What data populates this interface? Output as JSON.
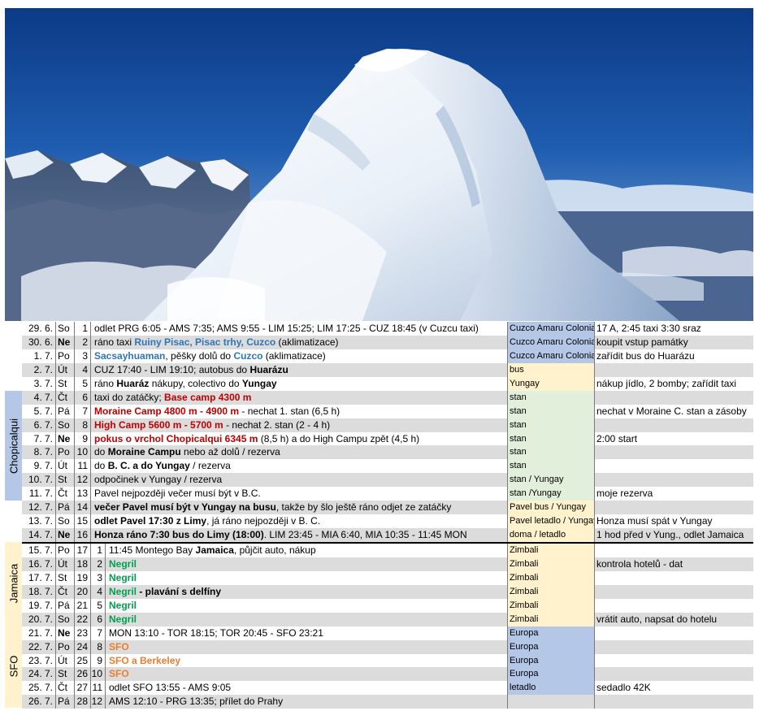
{
  "colors": {
    "accom_blue": "#b4c7e7",
    "accom_yellow": "#fff2cc",
    "accom_green": "#e2efda",
    "band_chopicalqui": "#b4c7e7",
    "band_jamaica": "#fff2cc",
    "band_sfo": "#fff2cc",
    "text_red": "#c00000",
    "text_blue": "#2e75b6",
    "text_green": "#00a050",
    "text_orange": "#ed7d31",
    "row_gray": "#dcdcdc"
  },
  "bands": [
    {
      "label": "Chopicalqui",
      "start": 5,
      "end": 12
    },
    {
      "label": "Jamaica",
      "start": 16,
      "end": 21
    },
    {
      "label": "SFO",
      "start": 22,
      "end": 27
    }
  ],
  "rows": [
    {
      "date": "29. 6.",
      "dow": "So",
      "dow_bold": false,
      "day": "1",
      "sub": "",
      "accom": "Cuzco Amaru Colonial",
      "accom_color": "blue",
      "note": "17 A, 2:45 taxi 3:30 sraz",
      "parts": [
        {
          "t": "odlet PRG 6:05 - AMS 7:35; AMS 9:55 - LIM 15:25; LIM 17:25 - CUZ 18:45  (v Cuzcu taxi)",
          "s": ""
        }
      ]
    },
    {
      "date": "30. 6.",
      "dow": "Ne",
      "dow_bold": true,
      "day": "2",
      "sub": "",
      "accom": "Cuzco Amaru Colonial",
      "accom_color": "blue",
      "note": "koupit vstup památky",
      "parts": [
        {
          "t": "ráno taxi ",
          "s": ""
        },
        {
          "t": "Ruiny Pisac, Pisac trhy, Cuzco",
          "s": "blue"
        },
        {
          "t": " (aklimatizace)",
          "s": ""
        }
      ]
    },
    {
      "date": "1. 7.",
      "dow": "Po",
      "dow_bold": false,
      "day": "3",
      "sub": "",
      "accom": "Cuzco Amaru Colonial",
      "accom_color": "blue",
      "note": "zařídit bus do Huarázu",
      "parts": [
        {
          "t": "Sacsayhuaman",
          "s": "blue"
        },
        {
          "t": ", pěšky dolů do ",
          "s": ""
        },
        {
          "t": "Cuzco",
          "s": "blue"
        },
        {
          "t": "  (aklimatizace)",
          "s": ""
        }
      ]
    },
    {
      "date": "2. 7.",
      "dow": "Út",
      "dow_bold": false,
      "day": "4",
      "sub": "",
      "accom": "bus",
      "accom_color": "yellow",
      "note": "",
      "parts": [
        {
          "t": "CUZ 17:40 - LIM 19:10; autobus do ",
          "s": ""
        },
        {
          "t": "Huarázu",
          "s": "bold"
        }
      ]
    },
    {
      "date": "3. 7.",
      "dow": "St",
      "dow_bold": false,
      "day": "5",
      "sub": "",
      "accom": "Yungay",
      "accom_color": "yellow",
      "note": "nákup jídlo, 2 bomby; zařídit taxi",
      "parts": [
        {
          "t": "ráno ",
          "s": ""
        },
        {
          "t": "Huaráz",
          "s": "bold"
        },
        {
          "t": " nákupy, colectivo do ",
          "s": ""
        },
        {
          "t": "Yungay",
          "s": "bold"
        }
      ]
    },
    {
      "date": "4. 7.",
      "dow": "Čt",
      "dow_bold": false,
      "day": "6",
      "sub": "",
      "accom": "stan",
      "accom_color": "green",
      "note": "",
      "parts": [
        {
          "t": "taxi do zatáčky; ",
          "s": ""
        },
        {
          "t": "Base camp 4300 m",
          "s": "red"
        }
      ]
    },
    {
      "date": "5. 7.",
      "dow": "Pá",
      "dow_bold": false,
      "day": "7",
      "sub": "",
      "accom": "stan",
      "accom_color": "green",
      "note": "nechat v Moraine C. stan a zásoby",
      "parts": [
        {
          "t": "Moraine Camp 4800 m - 4900 m",
          "s": "red"
        },
        {
          "t": " - nechat 1. stan (6,5 h)",
          "s": ""
        }
      ]
    },
    {
      "date": "6. 7.",
      "dow": "So",
      "dow_bold": false,
      "day": "8",
      "sub": "",
      "accom": "stan",
      "accom_color": "green",
      "note": "",
      "parts": [
        {
          "t": "High Camp 5600 m - 5700 m",
          "s": "red"
        },
        {
          "t": " - nechat 2. stan (2 - 4 h)",
          "s": ""
        }
      ]
    },
    {
      "date": "7. 7.",
      "dow": "Ne",
      "dow_bold": true,
      "day": "9",
      "sub": "",
      "accom": "stan",
      "accom_color": "green",
      "note": "2:00 start",
      "parts": [
        {
          "t": "pokus o vrchol Chopicalqui 6345 m",
          "s": "red"
        },
        {
          "t": " (8,5 h) a do High Campu zpět (4,5 h)",
          "s": ""
        }
      ]
    },
    {
      "date": "8. 7.",
      "dow": "Po",
      "dow_bold": false,
      "day": "10",
      "sub": "",
      "accom": "stan",
      "accom_color": "green",
      "note": "",
      "parts": [
        {
          "t": "do ",
          "s": ""
        },
        {
          "t": "Moraine Campu",
          "s": "bold"
        },
        {
          "t": " nebo až dolů / rezerva",
          "s": ""
        }
      ]
    },
    {
      "date": "9. 7.",
      "dow": "Út",
      "dow_bold": false,
      "day": "11",
      "sub": "",
      "accom": "stan",
      "accom_color": "green",
      "note": "",
      "parts": [
        {
          "t": "do ",
          "s": ""
        },
        {
          "t": "B. C. a do Yungay",
          "s": "bold"
        },
        {
          "t": " / rezerva",
          "s": ""
        }
      ]
    },
    {
      "date": "10. 7.",
      "dow": "St",
      "dow_bold": false,
      "day": "12",
      "sub": "",
      "accom": "stan / Yungay",
      "accom_color": "green",
      "note": "",
      "parts": [
        {
          "t": "odpočinek v Yungay / rezerva",
          "s": ""
        }
      ]
    },
    {
      "date": "11. 7.",
      "dow": "Čt",
      "dow_bold": false,
      "day": "13",
      "sub": "",
      "accom": "stan /Yungay",
      "accom_color": "green",
      "note": "moje rezerva",
      "parts": [
        {
          "t": "Pavel nejpozději večer musí být v B.C.",
          "s": ""
        }
      ]
    },
    {
      "date": "12. 7.",
      "dow": "Pá",
      "dow_bold": false,
      "day": "14",
      "sub": "",
      "accom": "Pavel bus / Yungay",
      "accom_color": "yellow",
      "note": "",
      "parts": [
        {
          "t": "večer Pavel musí být v Yungay na busu",
          "s": "bold"
        },
        {
          "t": ", takže by šlo ještě ráno odjet ze zatáčky",
          "s": ""
        }
      ]
    },
    {
      "date": "13. 7.",
      "dow": "So",
      "dow_bold": false,
      "day": "15",
      "sub": "",
      "accom": "Pavel letadlo / Yungay",
      "accom_color": "yellow",
      "note": "Honza musí spát v Yungay",
      "parts": [
        {
          "t": "odlet Pavel 17:30 z Limy",
          "s": "bold"
        },
        {
          "t": ", já ráno nejpozději v B. C.",
          "s": ""
        }
      ]
    },
    {
      "date": "14. 7.",
      "dow": "Ne",
      "dow_bold": true,
      "day": "16",
      "sub": "",
      "accom": "doma / letadlo",
      "accom_color": "yellow",
      "note": "1 hod před v Yung., odlet Jamaica",
      "parts": [
        {
          "t": "Honza ráno 7:30 bus do Limy (18:00)",
          "s": "bold"
        },
        {
          "t": ". LIM 23:45 - MIA 6:40, MIA 10:35 - 11:45 MON",
          "s": ""
        }
      ]
    },
    {
      "date": "15. 7.",
      "dow": "Po",
      "dow_bold": false,
      "day": "17",
      "sub": "1",
      "accom": "Zimbali",
      "accom_color": "yellow",
      "note": "",
      "parts": [
        {
          "t": "11:45 Montego Bay ",
          "s": ""
        },
        {
          "t": "Jamaica",
          "s": "bold"
        },
        {
          "t": ", půjčit auto, nákup",
          "s": ""
        }
      ]
    },
    {
      "date": "16. 7.",
      "dow": "Út",
      "dow_bold": false,
      "day": "18",
      "sub": "2",
      "accom": "Zimbali",
      "accom_color": "yellow",
      "note": "kontrola hotelů - dat",
      "parts": [
        {
          "t": "Negril",
          "s": "green"
        }
      ]
    },
    {
      "date": "17. 7.",
      "dow": "St",
      "dow_bold": false,
      "day": "19",
      "sub": "3",
      "accom": "Zimbali",
      "accom_color": "yellow",
      "note": "",
      "parts": [
        {
          "t": "Negril",
          "s": "green"
        }
      ]
    },
    {
      "date": "18. 7.",
      "dow": "Čt",
      "dow_bold": false,
      "day": "20",
      "sub": "4",
      "accom": "Zimbali",
      "accom_color": "yellow",
      "note": "",
      "parts": [
        {
          "t": "Negril",
          "s": "green"
        },
        {
          "t": " - plavání s delfíny",
          "s": "bold"
        }
      ]
    },
    {
      "date": "19. 7.",
      "dow": "Pá",
      "dow_bold": false,
      "day": "21",
      "sub": "5",
      "accom": "Zimbali",
      "accom_color": "yellow",
      "note": "",
      "parts": [
        {
          "t": "Negril",
          "s": "green"
        }
      ]
    },
    {
      "date": "20. 7.",
      "dow": "So",
      "dow_bold": false,
      "day": "22",
      "sub": "6",
      "accom": "Zimbali",
      "accom_color": "yellow",
      "note": "vrátit auto, napsat do hotelu",
      "parts": [
        {
          "t": "Negril",
          "s": "green"
        }
      ]
    },
    {
      "date": "21. 7.",
      "dow": "Ne",
      "dow_bold": true,
      "day": "23",
      "sub": "7",
      "accom": "Europa",
      "accom_color": "blue",
      "note": "",
      "parts": [
        {
          "t": "MON 13:10 - TOR 18:15; TOR 20:45 - SFO 23:21",
          "s": ""
        }
      ]
    },
    {
      "date": "22. 7.",
      "dow": "Po",
      "dow_bold": false,
      "day": "24",
      "sub": "8",
      "accom": "Europa",
      "accom_color": "blue",
      "note": "",
      "parts": [
        {
          "t": "SFO",
          "s": "orange"
        }
      ]
    },
    {
      "date": "23. 7.",
      "dow": "Út",
      "dow_bold": false,
      "day": "25",
      "sub": "9",
      "accom": "Europa",
      "accom_color": "blue",
      "note": "",
      "parts": [
        {
          "t": "SFO a Berkeley",
          "s": "orange"
        }
      ]
    },
    {
      "date": "24. 7.",
      "dow": "St",
      "dow_bold": false,
      "day": "26",
      "sub": "10",
      "accom": "Europa",
      "accom_color": "blue",
      "note": "",
      "parts": [
        {
          "t": "SFO",
          "s": "orange"
        }
      ]
    },
    {
      "date": "25. 7.",
      "dow": "Čt",
      "dow_bold": false,
      "day": "27",
      "sub": "11",
      "accom": "letadlo",
      "accom_color": "blue",
      "note": "sedadlo 42K",
      "parts": [
        {
          "t": "odlet SFO 13:55 - AMS 9:05",
          "s": ""
        }
      ]
    },
    {
      "date": "26. 7.",
      "dow": "Pá",
      "dow_bold": false,
      "day": "28",
      "sub": "12",
      "accom": "",
      "accom_color": "none",
      "note": "",
      "parts": [
        {
          "t": "AMS 12:10 - PRG 13:35; přílet do Prahy",
          "s": ""
        }
      ]
    }
  ]
}
